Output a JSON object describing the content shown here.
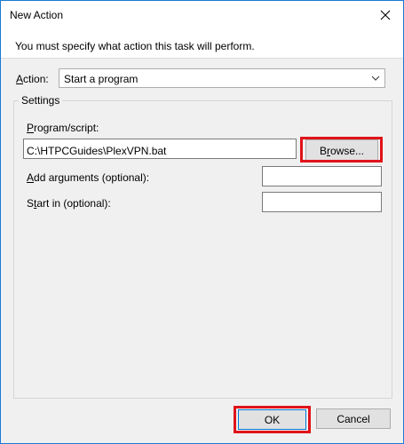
{
  "window": {
    "title": "New Action",
    "header_text": "You must specify what action this task will perform."
  },
  "action": {
    "label_accel": "A",
    "label_rest": "ction:",
    "selected": "Start a program"
  },
  "settings": {
    "group_label": "Settings",
    "program_label_accel": "P",
    "program_label_rest": "rogram/script:",
    "program_value": "C:\\HTPCGuides\\PlexVPN.bat",
    "browse_label_pre": "B",
    "browse_label_accel": "r",
    "browse_label_post": "owse...",
    "arguments_label_accel": "A",
    "arguments_label_rest": "dd arguments (optional):",
    "arguments_value": "",
    "startin_label_pre": "S",
    "startin_label_accel": "t",
    "startin_label_post": "art in (optional):",
    "startin_value": ""
  },
  "footer": {
    "ok_label": "OK",
    "cancel_label": "Cancel"
  },
  "colors": {
    "highlight": "#e0131a",
    "window_border": "#1a7ad4"
  },
  "icons": {
    "close": "close-icon",
    "dropdown": "chevron-down-icon"
  }
}
